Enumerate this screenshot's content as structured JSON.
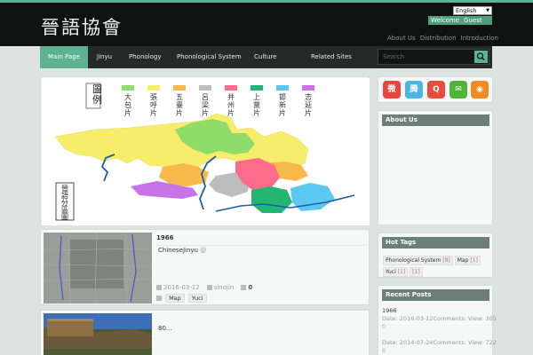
{
  "header": {
    "logo": "晉語協會",
    "language_select": "English",
    "welcome": "Welcome",
    "guest": "Guest",
    "top_links": [
      "About Us",
      "Distribution",
      "Introduction"
    ]
  },
  "nav": {
    "items": [
      "Main Page",
      "Jinyu",
      "Phonology",
      "Phonological System",
      "Culture",
      "Related Sites"
    ],
    "search_placeholder": "Search"
  },
  "map": {
    "legend_title": "圖例",
    "legend_items": [
      {
        "label": "大包片",
        "color": "#8fdc6a"
      },
      {
        "label": "張呼片",
        "color": "#f6ee6a"
      },
      {
        "label": "五臺片",
        "color": "#f9b84a"
      },
      {
        "label": "呂梁片",
        "color": "#bdbdbd"
      },
      {
        "label": "并州片",
        "color": "#ff6b8a"
      },
      {
        "label": "上黨片",
        "color": "#22b573"
      },
      {
        "label": "邯新片",
        "color": "#5ac8f0"
      },
      {
        "label": "志延片",
        "color": "#c873e8"
      }
    ],
    "caption": "晉語分區圖"
  },
  "posts": [
    {
      "title": "1966",
      "excerpt": "ChineseJinyu",
      "date": "2016-03-12",
      "author": "sinojin",
      "comments": "0",
      "tags": [
        "Map",
        "Yuci"
      ]
    },
    {
      "title": "",
      "excerpt": "80..."
    }
  ],
  "sidebar": {
    "social_icons": [
      "weibo-icon",
      "tencent-weibo-icon",
      "qq-icon",
      "wechat-icon",
      "rss-icon"
    ],
    "about_title": "About Us",
    "tags_title": "Hot Tags",
    "tags": [
      {
        "name": "Phonological System",
        "count": "[8]"
      },
      {
        "name": "Map",
        "count": "[1]"
      },
      {
        "name": "Yuci",
        "count": "[1]"
      },
      {
        "name": "",
        "count": "[1]"
      }
    ],
    "recent_title": "Recent Posts",
    "recent": [
      {
        "title": "1966",
        "meta": "Date: 2016-03-12Comments:   View: 305",
        "extra": "0"
      },
      {
        "title": "",
        "meta": "Date: 2014-07-24Comments:   View: 722",
        "extra": "0"
      }
    ]
  },
  "colors": {
    "accent": "#5db391",
    "header_bg": "#0f1211",
    "nav_bg": "#252a28",
    "widget_title_bg": "#6e7f79",
    "weibo": "#e8453c",
    "tencent": "#4bb5e4",
    "qq": "#e74c3c",
    "wechat": "#4fb53a",
    "rss": "#f08a24"
  }
}
